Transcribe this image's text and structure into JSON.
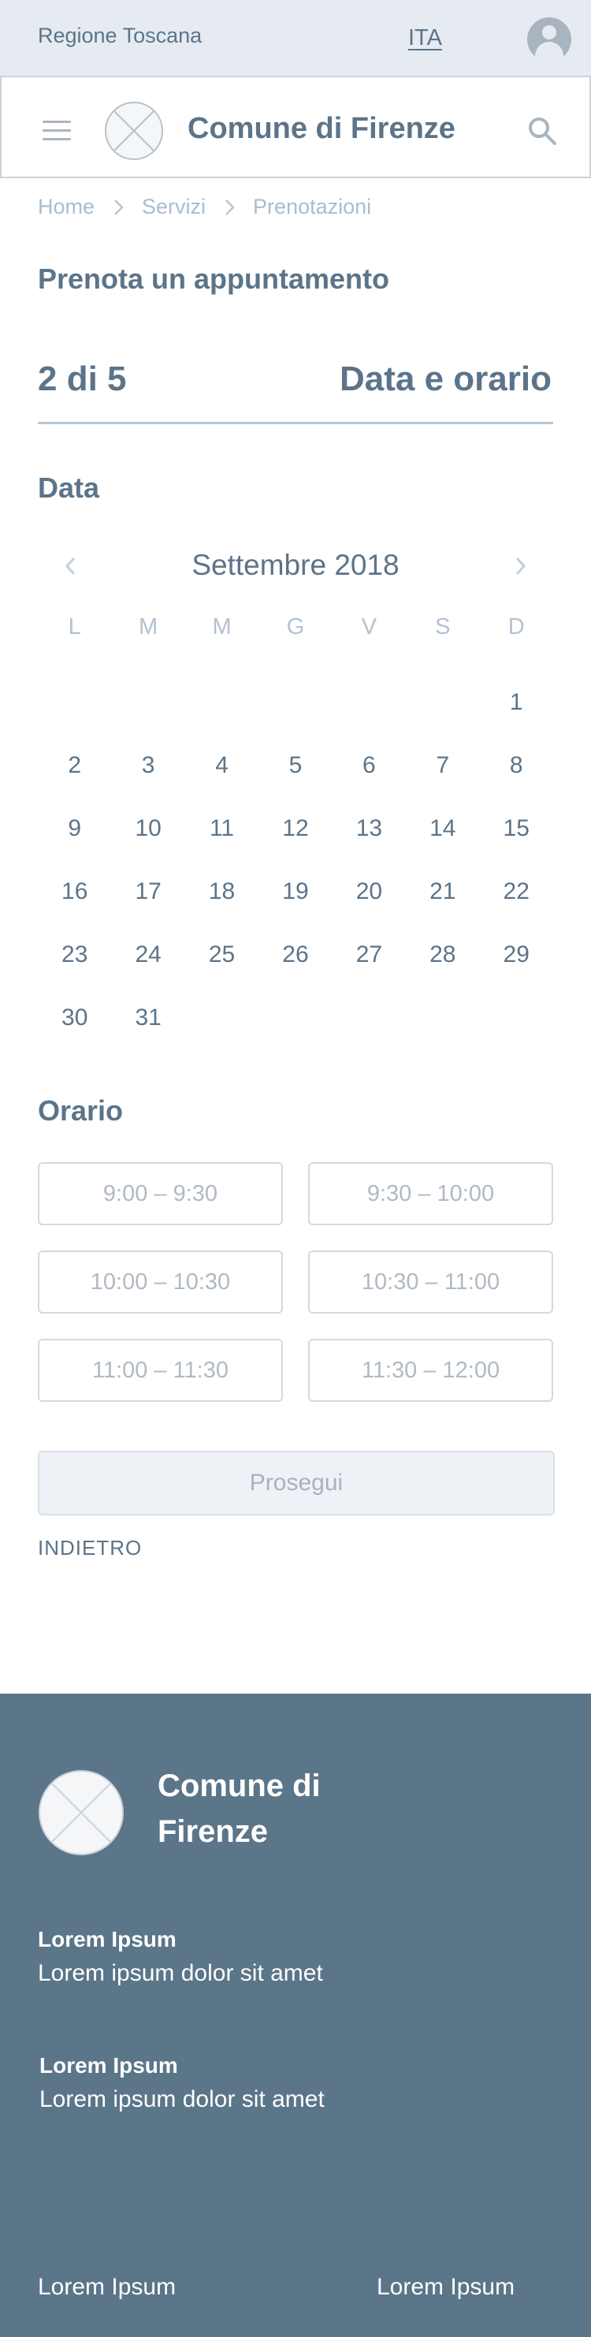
{
  "topbar": {
    "region": "Regione Toscana",
    "language": "ITA"
  },
  "header": {
    "title": "Comune di Firenze"
  },
  "breadcrumb": [
    "Home",
    "Servizi",
    "Prenotazioni"
  ],
  "page_title": "Prenota un appuntamento",
  "stepper": {
    "count": "2 di 5",
    "name": "Data e orario"
  },
  "date_section": {
    "label": "Data",
    "month": "Settembre 2018",
    "weekdays": [
      "L",
      "M",
      "M",
      "G",
      "V",
      "S",
      "D"
    ],
    "weeks": [
      [
        "",
        "",
        "",
        "",
        "",
        "",
        "1"
      ],
      [
        "2",
        "3",
        "4",
        "5",
        "6",
        "7",
        "8"
      ],
      [
        "9",
        "10",
        "11",
        "12",
        "13",
        "14",
        "15"
      ],
      [
        "16",
        "17",
        "18",
        "19",
        "20",
        "21",
        "22"
      ],
      [
        "23",
        "24",
        "25",
        "26",
        "27",
        "28",
        "29"
      ],
      [
        "30",
        "31",
        "",
        "",
        "",
        "",
        ""
      ]
    ]
  },
  "time_section": {
    "label": "Orario",
    "slots": [
      "9:00 – 9:30",
      "9:30 – 10:00",
      "10:00 – 10:30",
      "10:30 – 11:00",
      "11:00 – 11:30",
      "11:30 – 12:00"
    ]
  },
  "actions": {
    "continue": "Prosegui",
    "back": "INDIETRO"
  },
  "footer": {
    "title": "Comune di Firenze",
    "blocks": [
      {
        "heading": "Lorem Ipsum",
        "text": "Lorem ipsum dolor sit amet"
      },
      {
        "heading": "Lorem Ipsum",
        "text": "Lorem ipsum dolor sit amet"
      }
    ],
    "links": [
      "Lorem Ipsum",
      "Lorem Ipsum"
    ]
  },
  "colors": {
    "primary": "#5c7489",
    "footer_bg": "#5b7589",
    "topbar_bg": "#e6ebf2",
    "muted": "#a9bcd0"
  },
  "icons": {
    "menu": "hamburger-icon",
    "search": "search-icon",
    "user": "user-icon",
    "logo": "placeholder-logo-icon",
    "prev": "chevron-left-icon",
    "next": "chevron-right-icon",
    "separator": "chevron-right-icon"
  }
}
